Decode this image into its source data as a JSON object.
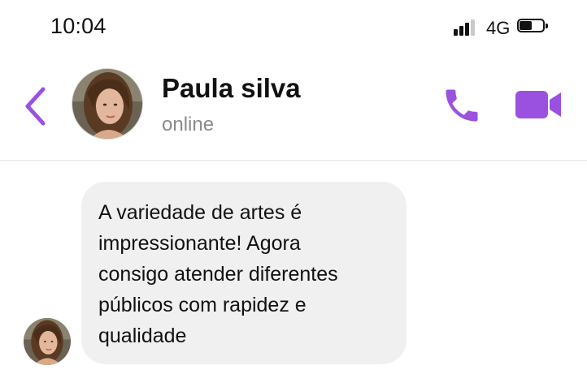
{
  "status_bar": {
    "time": "10:04",
    "network": "4G",
    "signal_bars": 3,
    "battery_level": 0.55
  },
  "header": {
    "contact_name": "Paula silva",
    "contact_status": "online",
    "back_icon": "chevron-left-icon",
    "call_icon": "phone-icon",
    "video_icon": "video-camera-icon"
  },
  "messages": [
    {
      "sender": "contact",
      "text": "A variedade de artes é\nimpressionante! Agora\nconsigo atender diferentes\npúblicos com rapidez e\nqualidade"
    }
  ],
  "colors": {
    "accent": "#9b51e0",
    "bubble_background": "#f0f0f0",
    "status_text": "#8a8a8a",
    "divider": "#e6e6e6"
  }
}
